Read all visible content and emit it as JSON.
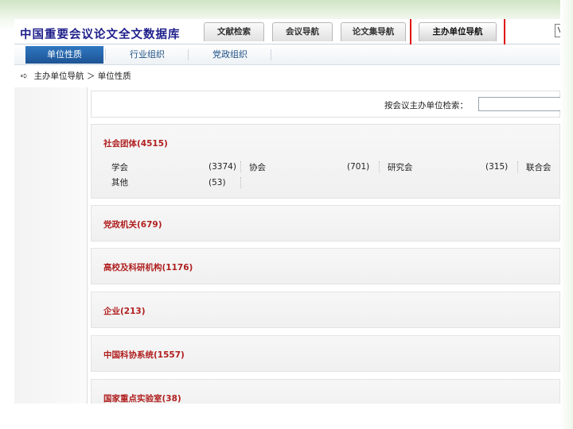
{
  "header": {
    "title": "中国重要会议论文全文数据库",
    "tabs": [
      {
        "label": "文献检索"
      },
      {
        "label": "会议导航"
      },
      {
        "label": "论文集导航"
      },
      {
        "label": "主办单位导航"
      }
    ],
    "search_stub": "V"
  },
  "subnav": {
    "tabs": [
      {
        "label": "单位性质"
      },
      {
        "label": "行业组织"
      },
      {
        "label": "党政组织"
      }
    ]
  },
  "breadcrumb": {
    "root": "主办单位导航",
    "separator": "＞",
    "current": "单位性质"
  },
  "search": {
    "label": "按会议主办单位检索：",
    "value": ""
  },
  "sections": [
    {
      "title": "社会团体(4515)",
      "items": [
        {
          "name": "学会",
          "count": "(3374)"
        },
        {
          "name": "协会",
          "count": "(701)"
        },
        {
          "name": "研究会",
          "count": "(315)"
        },
        {
          "name": "联合会",
          "count": ""
        },
        {
          "name": "其他",
          "count": "(53)"
        }
      ]
    },
    {
      "title": "党政机关(679)"
    },
    {
      "title": "高校及科研机构(1176)"
    },
    {
      "title": "企业(213)"
    },
    {
      "title": "中国科协系统(1557)"
    },
    {
      "title": "国家重点实验室(38)"
    }
  ],
  "colors": {
    "title": "#1f1f8c",
    "section_title": "#b01f1f",
    "active_subtab": "#1d5394",
    "highlight": "#e01010"
  }
}
